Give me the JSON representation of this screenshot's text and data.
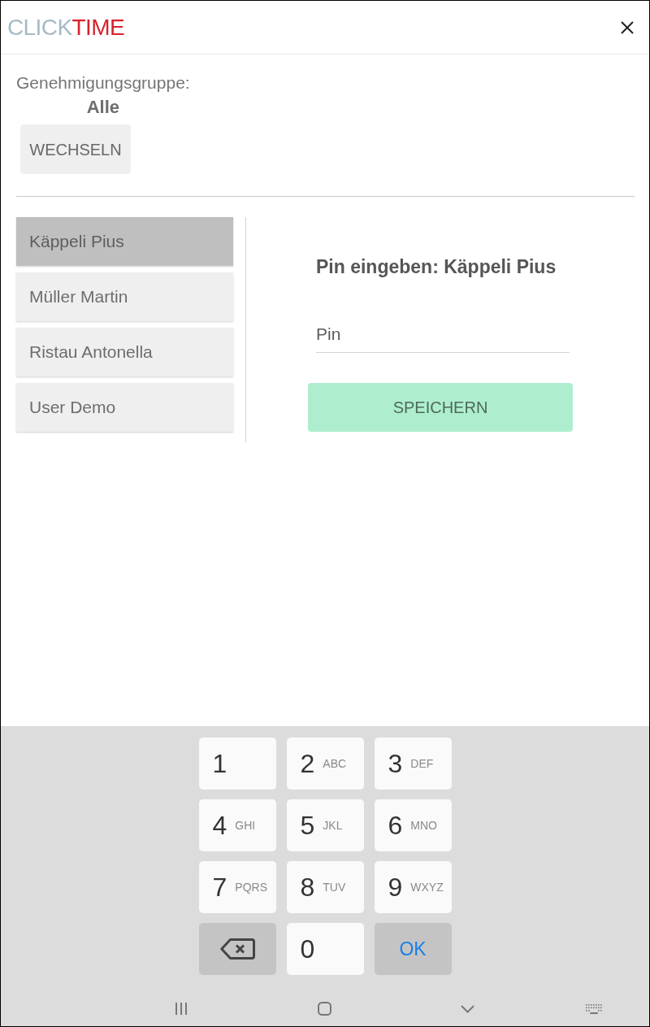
{
  "header": {
    "logo": {
      "first_part": "CLICK",
      "second_part": "TIME"
    }
  },
  "approval_group": {
    "label": "Genehmigungsgruppe:",
    "value": "Alle",
    "button": "WECHSELN"
  },
  "users": [
    {
      "name": "Käppeli Pius",
      "selected": true
    },
    {
      "name": "Müller Martin",
      "selected": false
    },
    {
      "name": "Ristau Antonella",
      "selected": false
    },
    {
      "name": "User Demo",
      "selected": false
    }
  ],
  "pin_panel": {
    "title": "Pin eingeben: Käppeli Pius",
    "placeholder": "Pin",
    "button": "SPEICHERN"
  },
  "keypad": [
    {
      "kind": "digit",
      "digit": "1"
    },
    {
      "kind": "digit",
      "digit": "2",
      "letters": "ABC"
    },
    {
      "kind": "digit",
      "digit": "3",
      "letters": "DEF"
    },
    {
      "kind": "digit",
      "digit": "4",
      "letters": "GHI"
    },
    {
      "kind": "digit",
      "digit": "5",
      "letters": "JKL"
    },
    {
      "kind": "digit",
      "digit": "6",
      "letters": "MNO"
    },
    {
      "kind": "digit",
      "digit": "7",
      "letters": "PQRS"
    },
    {
      "kind": "digit",
      "digit": "8",
      "letters": "TUV"
    },
    {
      "kind": "digit",
      "digit": "9",
      "letters": "WXYZ"
    },
    {
      "kind": "backspace"
    },
    {
      "kind": "digit",
      "digit": "0"
    },
    {
      "kind": "action",
      "label": "OK"
    }
  ]
}
